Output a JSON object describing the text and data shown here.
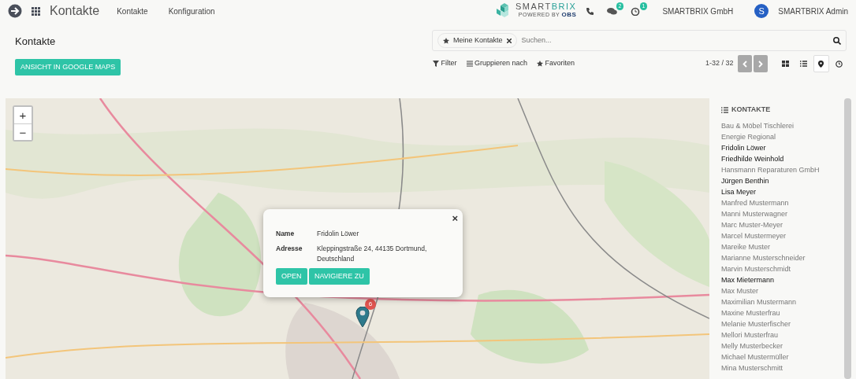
{
  "navbar": {
    "app_title": "Kontakte",
    "menu": [
      {
        "label": "Kontakte"
      },
      {
        "label": "Konfiguration"
      }
    ],
    "brand": {
      "name_dark": "SMART",
      "name_accent": "BRIX",
      "tagline_prefix": "POWERED BY",
      "tagline_brand": "OBS"
    },
    "messages_badge": "2",
    "activities_badge": "1",
    "company": "SMARTBRIX GmbH",
    "user_initial": "S",
    "user": "SMARTBRIX Admin"
  },
  "control_panel": {
    "breadcrumb": "Kontakte",
    "primary_button": "ANSICHT IN GOOGLE MAPS",
    "search": {
      "facet": "Meine Kontakte",
      "placeholder": "Suchen..."
    },
    "filters": [
      {
        "label": "Filter",
        "kind": "filter"
      },
      {
        "label": "Gruppieren nach",
        "kind": "group"
      },
      {
        "label": "Favoriten",
        "kind": "star"
      }
    ],
    "pager": "1-32 / 32",
    "views": [
      {
        "kind": "kanban",
        "selected": false
      },
      {
        "kind": "list",
        "selected": false
      },
      {
        "kind": "map",
        "selected": true
      },
      {
        "kind": "activity",
        "selected": false
      }
    ]
  },
  "map": {
    "kind": "picture",
    "zoom_in": "+",
    "zoom_out": "−",
    "popup": {
      "close": "×",
      "fields": [
        {
          "label": "Name",
          "value": "Fridolin Löwer"
        },
        {
          "label": "Adresse",
          "value": "Kleppingstraße 24, 44135 Dortmund, Deutschland"
        }
      ],
      "buttons": [
        "OPEN",
        "NAVIGIERE ZU"
      ]
    },
    "marker_count": "6"
  },
  "sidebar": {
    "title": "KONTAKTE",
    "items": [
      {
        "name": "Bau & Möbel Tischlerei",
        "located": false
      },
      {
        "name": "Energie Regional",
        "located": false
      },
      {
        "name": "Fridolin Löwer",
        "located": true
      },
      {
        "name": "Friedhilde Weinhold",
        "located": true
      },
      {
        "name": "Hansmann Reparaturen GmbH",
        "located": false
      },
      {
        "name": "Jürgen Benthin",
        "located": true
      },
      {
        "name": "Lisa Meyer",
        "located": true
      },
      {
        "name": "Manfred Mustermann",
        "located": false
      },
      {
        "name": "Manni Musterwagner",
        "located": false
      },
      {
        "name": "Marc Muster-Meyer",
        "located": false
      },
      {
        "name": "Marcel Mustermeyer",
        "located": false
      },
      {
        "name": "Mareike Muster",
        "located": false
      },
      {
        "name": "Marianne Musterschneider",
        "located": false
      },
      {
        "name": "Marvin Musterschmidt",
        "located": false
      },
      {
        "name": "Max Mietermann",
        "located": true
      },
      {
        "name": "Max Muster",
        "located": false
      },
      {
        "name": "Maximilian Mustermann",
        "located": false
      },
      {
        "name": "Maxine Musterfrau",
        "located": false
      },
      {
        "name": "Melanie Musterfischer",
        "located": false
      },
      {
        "name": "Mellori Musterfrau",
        "located": false
      },
      {
        "name": "Melly Musterbecker",
        "located": false
      },
      {
        "name": "Michael Mustermüller",
        "located": false
      },
      {
        "name": "Mina Musterschmitt",
        "located": false
      }
    ]
  }
}
